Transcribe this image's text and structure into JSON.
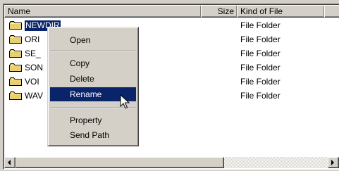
{
  "columns": {
    "name": "Name",
    "size": "Size",
    "kind": "Kind of File"
  },
  "files": [
    {
      "name": "NEWDIR",
      "kind": "File Folder"
    },
    {
      "name": "ORI",
      "kind": "File Folder"
    },
    {
      "name": "SE_",
      "kind": "File Folder"
    },
    {
      "name": "SON",
      "kind": "File Folder"
    },
    {
      "name": "VOI",
      "kind": "File Folder"
    },
    {
      "name": "WAV",
      "kind": "File Folder"
    }
  ],
  "context_menu": {
    "open": "Open",
    "copy": "Copy",
    "delete": "Delete",
    "rename": "Rename",
    "property": "Property",
    "send_path": "Send Path"
  },
  "colors": {
    "selection": "#0a246a",
    "face": "#d4d0c8",
    "folder": "#e8d070"
  }
}
